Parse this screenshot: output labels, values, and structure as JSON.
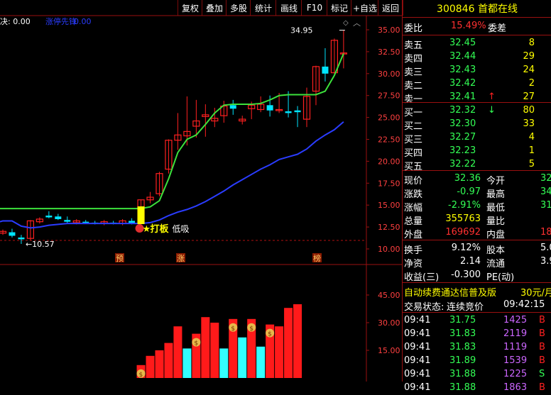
{
  "toolbar": {
    "buttons": [
      "复权",
      "叠加",
      "多股",
      "统计",
      "画线",
      "F10",
      "标记",
      "+自选",
      "返回"
    ]
  },
  "indicator": {
    "text1": "决: 0.00",
    "text2": "涨停先锋",
    "text3": "0.00"
  },
  "chart": {
    "price_axis_labels": [
      "35.00",
      "32.50",
      "30.00",
      "27.50",
      "25.00",
      "22.50",
      "20.00",
      "17.50",
      "15.00",
      "12.50",
      "10.00"
    ],
    "high_label": "34.95",
    "low_label": "10.57",
    "signal_label": "打板",
    "signal_label2": "低吸",
    "markers": [
      "预",
      "涨",
      "榜"
    ],
    "volume_axis_labels": [
      "45.00",
      "30.00",
      "15.00"
    ]
  },
  "chart_data": [
    {
      "type": "candlestick",
      "title": "",
      "ylim": [
        10,
        35
      ],
      "ohlc": [
        [
          11.8,
          12.2,
          11.6,
          12.0
        ],
        [
          11.9,
          12.3,
          11.3,
          11.5
        ],
        [
          11.3,
          11.6,
          10.57,
          11.1
        ],
        [
          11.2,
          13.3,
          11.0,
          13.2
        ],
        [
          13.1,
          13.6,
          12.9,
          13.4
        ],
        [
          13.8,
          14.3,
          13.5,
          13.6
        ],
        [
          13.7,
          14.0,
          13.3,
          13.4
        ],
        [
          13.3,
          13.7,
          12.9,
          13.1
        ],
        [
          13.0,
          13.4,
          12.8,
          13.2
        ],
        [
          13.1,
          13.3,
          12.9,
          13.0
        ],
        [
          13.0,
          13.2,
          12.8,
          12.9
        ],
        [
          12.9,
          13.3,
          12.7,
          13.1
        ],
        [
          13.0,
          13.2,
          12.8,
          12.9
        ],
        [
          12.9,
          13.4,
          12.7,
          13.2
        ],
        [
          13.2,
          13.5,
          12.8,
          12.9
        ],
        [
          13.0,
          15.6,
          12.8,
          15.6
        ],
        [
          15.6,
          16.5,
          15.2,
          15.9
        ],
        [
          16.3,
          18.8,
          16.0,
          18.6
        ],
        [
          19.1,
          22.5,
          18.6,
          22.4
        ],
        [
          22.4,
          25.5,
          21.3,
          23.0
        ],
        [
          22.9,
          27.4,
          21.8,
          23.4
        ],
        [
          24.0,
          27.0,
          22.7,
          24.6
        ],
        [
          25.1,
          26.5,
          22.8,
          25.3
        ],
        [
          24.6,
          26.1,
          23.9,
          24.9
        ],
        [
          25.2,
          26.9,
          24.4,
          26.3
        ],
        [
          26.4,
          27.0,
          25.3,
          26.0
        ],
        [
          24.6,
          25.2,
          24.2,
          24.8
        ],
        [
          26.0,
          26.8,
          24.8,
          26.4
        ],
        [
          25.9,
          27.4,
          25.6,
          26.5
        ],
        [
          26.4,
          27.5,
          25.1,
          25.8
        ],
        [
          25.8,
          27.8,
          25.5,
          25.9
        ],
        [
          25.7,
          28.0,
          25.0,
          25.5
        ],
        [
          25.8,
          26.3,
          23.9,
          25.6
        ],
        [
          24.8,
          28.4,
          23.9,
          27.4
        ],
        [
          28.0,
          30.9,
          26.4,
          30.8
        ],
        [
          30.8,
          32.9,
          29.1,
          30.0
        ],
        [
          30.1,
          34.0,
          30.0,
          33.8
        ],
        [
          32.3,
          34.95,
          30.6,
          32.36
        ]
      ],
      "green_line": [
        14.6,
        14.6,
        14.6,
        14.6,
        14.6,
        14.6,
        14.6,
        14.6,
        14.6,
        14.6,
        14.6,
        14.6,
        14.6,
        14.6,
        14.6,
        14.6,
        14.8,
        15.5,
        18.0,
        21.0,
        22.5,
        23.0,
        24.2,
        25.5,
        26.4,
        26.5,
        26.5,
        26.5,
        26.6,
        27.0,
        27.5,
        27.6,
        27.6,
        27.6,
        27.6,
        28.0,
        29.8,
        32.3
      ],
      "blue_line": [
        13.2,
        13.2,
        12.6,
        12.4,
        12.5,
        12.7,
        12.8,
        12.9,
        12.9,
        12.9,
        12.9,
        12.9,
        12.9,
        12.9,
        12.9,
        12.9,
        13.0,
        13.3,
        13.8,
        14.2,
        14.5,
        14.9,
        15.4,
        16.0,
        16.6,
        17.3,
        17.9,
        18.5,
        19.1,
        19.6,
        20.2,
        20.5,
        20.8,
        21.4,
        22.3,
        23.0,
        23.6,
        24.5
      ]
    },
    {
      "type": "bar",
      "title": "",
      "ylim": [
        0,
        60
      ],
      "categories": [
        "d1",
        "d2",
        "d3",
        "d4",
        "d5",
        "d6",
        "d7",
        "d8",
        "d9",
        "d10",
        "d11",
        "d12",
        "d13",
        "d14",
        "d15",
        "d16",
        "d17",
        "d18"
      ],
      "values": [
        7,
        12,
        15,
        19,
        28,
        16,
        24,
        33,
        30,
        16,
        32,
        22,
        32,
        17,
        29,
        28,
        38,
        40
      ],
      "colors": [
        "red",
        "red",
        "red",
        "red",
        "red",
        "cyan",
        "red",
        "red",
        "red",
        "cyan",
        "red",
        "cyan",
        "red",
        "cyan",
        "red",
        "red",
        "red",
        "red"
      ]
    }
  ],
  "quote": {
    "code": "300846",
    "name": "首都在线",
    "webi_label": "委比",
    "webi_value": "15.49%",
    "weicha_label": "委差",
    "asks": [
      [
        "卖五",
        "32.45",
        "8"
      ],
      [
        "卖四",
        "32.44",
        "29"
      ],
      [
        "卖三",
        "32.43",
        "24"
      ],
      [
        "卖二",
        "32.42",
        "2"
      ],
      [
        "卖一",
        "32.41",
        "27"
      ]
    ],
    "bids": [
      [
        "买一",
        "32.32",
        "80"
      ],
      [
        "买二",
        "32.30",
        "33"
      ],
      [
        "买三",
        "32.27",
        "4"
      ],
      [
        "买四",
        "32.23",
        "1"
      ],
      [
        "买五",
        "32.22",
        "5"
      ]
    ],
    "stats": [
      [
        "现价",
        "32.36",
        "今开",
        "32"
      ],
      [
        "涨跌",
        "-0.97",
        "最高",
        "34"
      ],
      [
        "涨幅",
        "-2.91%",
        "最低",
        "31"
      ],
      [
        "总量",
        "355763",
        "量比",
        ""
      ],
      [
        "外盘",
        "169692",
        "内盘",
        "186"
      ]
    ],
    "stats2": [
      [
        "换手",
        "9.12%",
        "股本",
        "5.0"
      ],
      [
        "净资",
        "2.14",
        "流通",
        "3.9"
      ],
      [
        "收益(三)",
        "-0.300",
        "PE(动)",
        ""
      ]
    ],
    "ad_text": "自动续费通达信普及版",
    "ad_price": "30元/月",
    "status_label": "交易状态:",
    "status_value": "连续竞价",
    "status_time": "09:42:15",
    "ticks": [
      [
        "09:41",
        "31.75",
        "1425",
        "B"
      ],
      [
        "09:41",
        "31.83",
        "2119",
        "B"
      ],
      [
        "09:41",
        "31.83",
        "1119",
        "B"
      ],
      [
        "09:41",
        "31.89",
        "1539",
        "B"
      ],
      [
        "09:41",
        "31.88",
        "1225",
        "S"
      ],
      [
        "09:41",
        "31.88",
        "1863",
        "B"
      ]
    ]
  },
  "colors": {
    "up": "#ff2020",
    "down": "#00e5ff",
    "grid": "#9a1010",
    "green_line": "#3ce23c",
    "blue_line": "#2a3cff",
    "yellow": "#ffff00"
  }
}
